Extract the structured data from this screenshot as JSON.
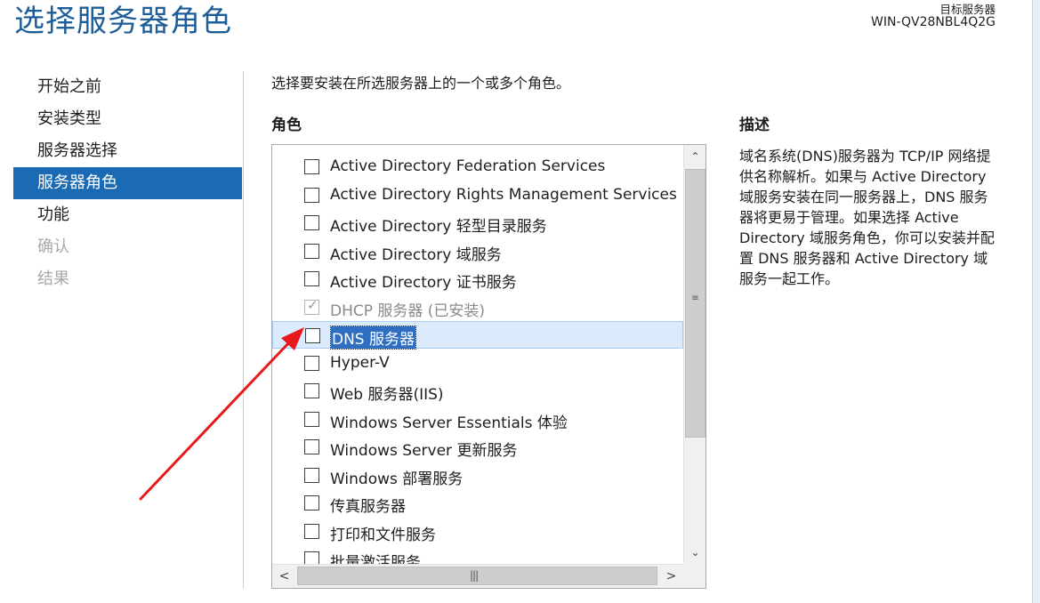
{
  "page": {
    "title": "选择服务器角色",
    "target_label": "目标服务器",
    "target_name": "WIN-QV28NBL4Q2G"
  },
  "nav": {
    "items": [
      {
        "label": "开始之前",
        "state": "normal"
      },
      {
        "label": "安装类型",
        "state": "normal"
      },
      {
        "label": "服务器选择",
        "state": "normal"
      },
      {
        "label": "服务器角色",
        "state": "active"
      },
      {
        "label": "功能",
        "state": "normal"
      },
      {
        "label": "确认",
        "state": "disabled"
      },
      {
        "label": "结果",
        "state": "disabled"
      }
    ]
  },
  "main": {
    "instruction": "选择要安装在所选服务器上的一个或多个角色。",
    "roles_heading": "角色",
    "description_heading": "描述",
    "description_text": "域名系统(DNS)服务器为 TCP/IP 网络提供名称解析。如果与 Active Directory 域服务安装在同一服务器上，DNS 服务器将更易于管理。如果选择 Active Directory 域服务角色，你可以安装并配置 DNS 服务器和 Active Directory 域服务一起工作。",
    "roles": [
      {
        "label": "Active Directory Federation Services",
        "checked": false,
        "disabled": false,
        "selected": false
      },
      {
        "label": "Active Directory Rights Management Services",
        "checked": false,
        "disabled": false,
        "selected": false
      },
      {
        "label": "Active Directory 轻型目录服务",
        "checked": false,
        "disabled": false,
        "selected": false
      },
      {
        "label": "Active Directory 域服务",
        "checked": false,
        "disabled": false,
        "selected": false
      },
      {
        "label": "Active Directory 证书服务",
        "checked": false,
        "disabled": false,
        "selected": false
      },
      {
        "label": "DHCP 服务器 (已安装)",
        "checked": true,
        "disabled": true,
        "selected": false
      },
      {
        "label": "DNS 服务器",
        "checked": false,
        "disabled": false,
        "selected": true
      },
      {
        "label": "Hyper-V",
        "checked": false,
        "disabled": false,
        "selected": false
      },
      {
        "label": "Web 服务器(IIS)",
        "checked": false,
        "disabled": false,
        "selected": false
      },
      {
        "label": "Windows Server Essentials 体验",
        "checked": false,
        "disabled": false,
        "selected": false
      },
      {
        "label": "Windows Server 更新服务",
        "checked": false,
        "disabled": false,
        "selected": false
      },
      {
        "label": "Windows 部署服务",
        "checked": false,
        "disabled": false,
        "selected": false
      },
      {
        "label": "传真服务器",
        "checked": false,
        "disabled": false,
        "selected": false
      },
      {
        "label": "打印和文件服务",
        "checked": false,
        "disabled": false,
        "selected": false
      },
      {
        "label": "批量激活服务",
        "checked": false,
        "disabled": false,
        "selected": false
      }
    ]
  },
  "scrollbar": {
    "up_glyph": "⌃",
    "down_glyph": "⌄",
    "left_glyph": "<",
    "right_glyph": ">",
    "grip_v": "≡",
    "grip_h": "|||"
  },
  "annotation": {
    "arrow_color": "#e8191b",
    "icon": "red-arrow-icon"
  },
  "colors": {
    "accent": "#1b6ab4",
    "title": "#1e5e98",
    "selection": "#dcebfc",
    "highlight": "#2f6fc2"
  }
}
